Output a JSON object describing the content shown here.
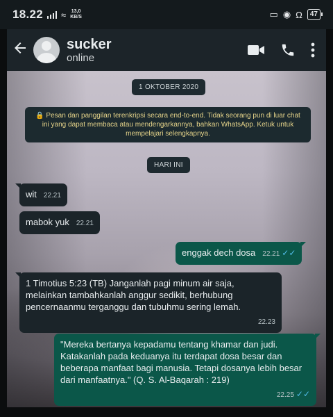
{
  "status_bar": {
    "time": "18.22",
    "net_speed_value": "13,0",
    "net_speed_unit": "KB/S",
    "battery": "47"
  },
  "header": {
    "back_icon": "arrow-left-icon",
    "contact_name": "sucker",
    "contact_status": "online",
    "icons": [
      "video-call-icon",
      "voice-call-icon",
      "more-vert-icon"
    ]
  },
  "chat": {
    "date_chip": "1 OKTOBER 2020",
    "encryption_notice": "🔒 Pesan dan panggilan terenkripsi secara end-to-end. Tidak seorang pun di luar chat ini yang dapat membaca atau mendengarkannya, bahkan WhatsApp. Ketuk untuk mempelajari selengkapnya.",
    "today_chip": "HARI INI",
    "messages": [
      {
        "dir": "in",
        "text": "wit",
        "time": "22.21"
      },
      {
        "dir": "in",
        "text": "mabok yuk",
        "time": "22.21"
      },
      {
        "dir": "out",
        "text": "enggak dech dosa",
        "time": "22.21",
        "ticks": "✓✓"
      },
      {
        "dir": "in",
        "text": "1 Timotius 5:23 (TB) Janganlah pagi minum air saja, melainkan tambahkanlah anggur sedikit, berhubung pencernaanmu terganggu dan tubuhmu sering lemah.",
        "time": "22.23"
      },
      {
        "dir": "out",
        "text": "\"Mereka bertanya kepadamu tentang khamar dan judi. Katakanlah pada keduanya itu terdapat dosa besar dan beberapa manfaat bagi manusia. Tetapi dosanya lebih besar dari manfaatnya.\" (Q. S. Al-Baqarah : 219)",
        "time": "22.25",
        "ticks": "✓✓"
      }
    ]
  },
  "colors": {
    "incoming_bubble": "#1b2429",
    "outgoing_bubble": "#0b5749",
    "read_ticks": "#53bdeb",
    "header": "#1c2429"
  }
}
